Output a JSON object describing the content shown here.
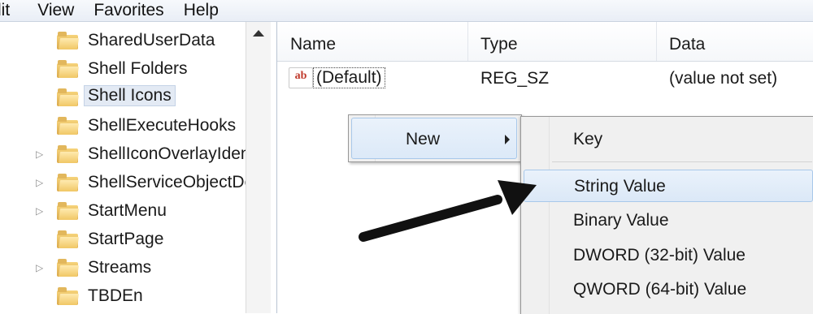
{
  "menubar": {
    "items": [
      "dit",
      "View",
      "Favorites",
      "Help"
    ]
  },
  "tree": {
    "items": [
      {
        "label": "SharedUserData",
        "expandable": false,
        "selected": false
      },
      {
        "label": "Shell Folders",
        "expandable": false,
        "selected": false
      },
      {
        "label": "Shell Icons",
        "expandable": false,
        "selected": true
      },
      {
        "label": "ShellExecuteHooks",
        "expandable": false,
        "selected": false
      },
      {
        "label": "ShellIconOverlayIdentifiers",
        "expandable": true,
        "selected": false
      },
      {
        "label": "ShellServiceObjectDelayLoad",
        "expandable": true,
        "selected": false
      },
      {
        "label": "StartMenu",
        "expandable": true,
        "selected": false
      },
      {
        "label": "StartPage",
        "expandable": false,
        "selected": false
      },
      {
        "label": "Streams",
        "expandable": true,
        "selected": false
      },
      {
        "label": "TBDEn",
        "expandable": false,
        "selected": false
      }
    ]
  },
  "list": {
    "columns": [
      "Name",
      "Type",
      "Data"
    ],
    "rows": [
      {
        "icon": "ab",
        "name": "(Default)",
        "type": "REG_SZ",
        "data": "(value not set)"
      }
    ]
  },
  "context_menu": {
    "new_label": "New"
  },
  "submenu": {
    "items": [
      {
        "label": "Key",
        "highlighted": false
      },
      {
        "label": "String Value",
        "highlighted": true
      },
      {
        "label": "Binary Value",
        "highlighted": false
      },
      {
        "label": "DWORD (32-bit) Value",
        "highlighted": false
      },
      {
        "label": "QWORD (64-bit) Value",
        "highlighted": false
      }
    ]
  },
  "colors": {
    "highlight_bg": "#dce9f8",
    "highlight_border": "#a8c8ea",
    "folder": "#f1c765",
    "annotation_arrow": "#111111"
  }
}
